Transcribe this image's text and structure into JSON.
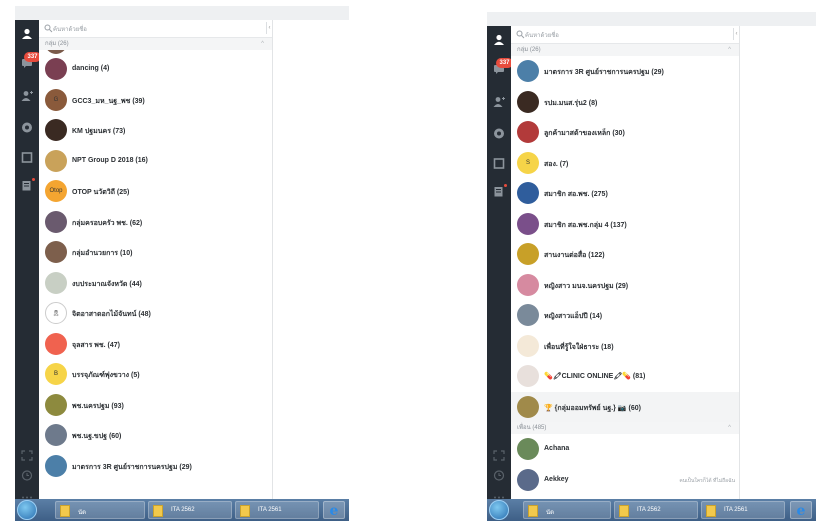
{
  "left": {
    "badge": "337",
    "search_placeholder": "ค้นหาด้วยชื่อ",
    "group_section": "กลุ่ม (26)",
    "items": [
      {
        "name": "dancing (4)",
        "color": "#7a3f52",
        "text": ""
      },
      {
        "name": "GCC3_มห_นฐ_พช (39)",
        "color": "#8a5a3b",
        "text": "G"
      },
      {
        "name": "KM ปฐมนคร (73)",
        "color": "#3a2a22",
        "text": ""
      },
      {
        "name": "NPT Group D 2018 (16)",
        "color": "#c9a25a",
        "text": ""
      },
      {
        "name": "OTOP นวัตวิถี (25)",
        "color": "#f4a531",
        "text": "Otop"
      },
      {
        "name": "กลุ่มครอบครัว พช. (62)",
        "color": "#6a5a6e",
        "text": ""
      },
      {
        "name": "กลุ่มอำนวยการ (10)",
        "color": "#7d5f4c",
        "text": ""
      },
      {
        "name": "งบประมาณจังหวัด (44)",
        "color": "#c8cfc4",
        "text": ""
      },
      {
        "name": "จิตอาสาดอกไม้จันทน์ (48)",
        "color": "#ffffff",
        "text": "🎗"
      },
      {
        "name": "จุลสาร พช. (47)",
        "color": "#f0624f",
        "text": ""
      },
      {
        "name": "บรรจุภัณฑ์พุ่งขวาง (5)",
        "color": "#f6d448",
        "text": "B"
      },
      {
        "name": "พช.นครปฐม (93)",
        "color": "#8d8a3e",
        "text": ""
      },
      {
        "name": "พช.นฐ.ขปฐ (60)",
        "color": "#6e7a8c",
        "text": ""
      },
      {
        "name": "มาตรการ 3R ศูนย์ราชการนครปฐม (29)",
        "color": "#4c7fa8",
        "text": ""
      }
    ],
    "taskbar": [
      "นัด",
      "ITA 2562",
      "ITA 2561"
    ]
  },
  "right": {
    "badge": "337",
    "search_placeholder": "ค้นหาด้วยชื่อ",
    "group_section": "กลุ่ม (26)",
    "friends_section": "เพื่อน (485)",
    "items": [
      {
        "name": "มาตรการ 3R ศูนย์ราชการนครปฐม (29)",
        "color": "#4c7fa8",
        "text": ""
      },
      {
        "name": "รปม.มนส.รุ่น2 (8)",
        "color": "#3a2a22",
        "text": ""
      },
      {
        "name": "ลูกค้ามาสด้าของเหล็ก (30)",
        "color": "#b23a3a",
        "text": ""
      },
      {
        "name": "สอง. (7)",
        "color": "#f6d448",
        "text": "S"
      },
      {
        "name": "สมาชิก สอ.พช. (275)",
        "color": "#2f5d9c",
        "text": ""
      },
      {
        "name": "สมาชิก สอ.พช.กลุ่ม 4 (137)",
        "color": "#7a4f8a",
        "text": ""
      },
      {
        "name": "สานงานต่อสื่อ (122)",
        "color": "#c8a028",
        "text": ""
      },
      {
        "name": "หญิงสาว มนจ.นครปฐม (29)",
        "color": "#d68aa0",
        "text": ""
      },
      {
        "name": "หญิงสาวแอ็ปปี (14)",
        "color": "#7a8a9a",
        "text": ""
      },
      {
        "name": "เพื่อนที่รู้ใจใฝ่ธาระ (18)",
        "color": "#f4e9d8",
        "text": ""
      },
      {
        "name": "💊🖍CLINIC ONLINE🖍💊 (81)",
        "color": "#e8e0dc",
        "text": ""
      }
    ],
    "highlight_item": {
      "name": "🏆 {กลุ่มออมทรัพย์ นฐ.} 📷 (60)",
      "color": "#a08a4a"
    },
    "friends": [
      {
        "name": "Achana",
        "color": "#6a8a5a"
      },
      {
        "name": "Aekkey",
        "color": "#5a6a8a",
        "note": "คนเป็นใครก็ได้ ที่ไม่ถือฉัน"
      }
    ],
    "taskbar": [
      "นัด",
      "ITA 2562",
      "ITA 2561"
    ]
  }
}
